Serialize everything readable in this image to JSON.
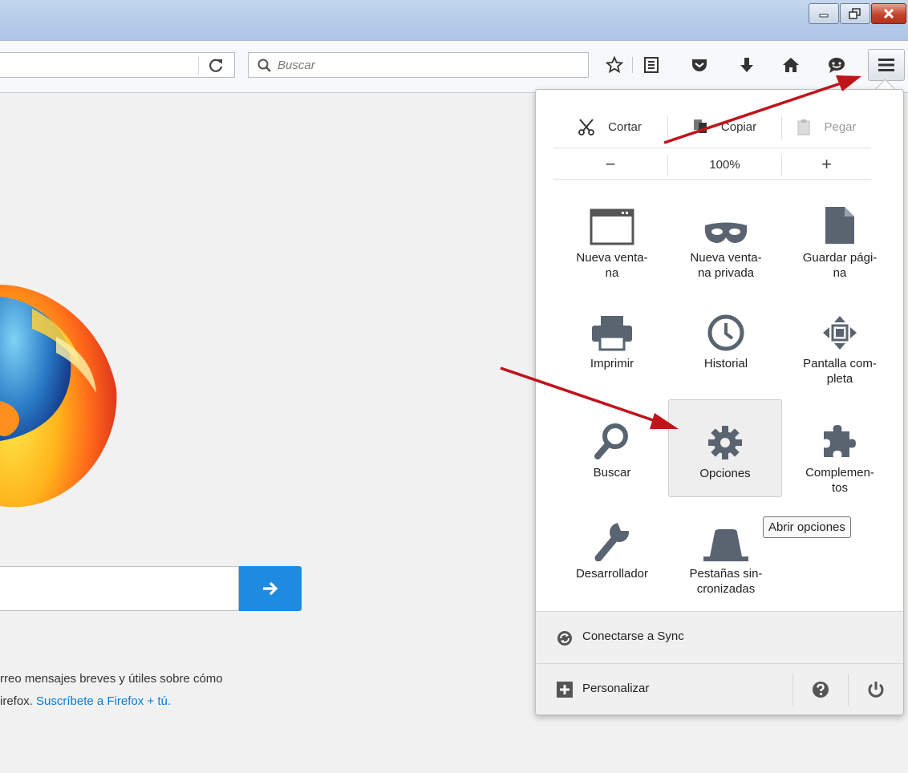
{
  "browser": {
    "search_placeholder": "Buscar"
  },
  "toolbar_icons": [
    "star-icon",
    "reading-list-icon",
    "pocket-icon",
    "download-icon",
    "home-icon",
    "chat-icon",
    "hamburger-menu-icon"
  ],
  "page": {
    "promo_line1": "rreo mensajes breves y útiles sobre cómo",
    "promo_line2_prefix": "irefox.",
    "promo_link": "Suscríbete a Firefox + tú."
  },
  "menu": {
    "edit": {
      "cut": "Cortar",
      "copy": "Copiar",
      "paste": "Pegar"
    },
    "zoom": {
      "minus": "−",
      "level": "100%",
      "plus": "+"
    },
    "items": [
      {
        "label": "Nueva venta-\nna",
        "icon": "new-window-icon"
      },
      {
        "label": "Nueva venta-\nna privada",
        "icon": "private-mask-icon"
      },
      {
        "label": "Guardar pági-\nna",
        "icon": "save-page-icon"
      },
      {
        "label": "Imprimir",
        "icon": "printer-icon"
      },
      {
        "label": "Historial",
        "icon": "clock-icon"
      },
      {
        "label": "Pantalla com-\npleta",
        "icon": "fullscreen-icon"
      },
      {
        "label": "Buscar",
        "icon": "magnifier-icon"
      },
      {
        "label": "Opciones",
        "icon": "gear-icon"
      },
      {
        "label": "Complemen-\ntos",
        "icon": "puzzle-icon"
      },
      {
        "label": "Desarrollador",
        "icon": "wrench-icon"
      },
      {
        "label": "Pestañas sin-\ncronizadas",
        "icon": "synced-tabs-icon"
      }
    ],
    "tooltip": "Abrir opciones",
    "sync_label": "Conectarse a Sync",
    "customize_label": "Personalizar"
  },
  "colors": {
    "annotation_arrow": "#c0141b",
    "go_button": "#1e8ae0",
    "link": "#0a7bd4"
  }
}
